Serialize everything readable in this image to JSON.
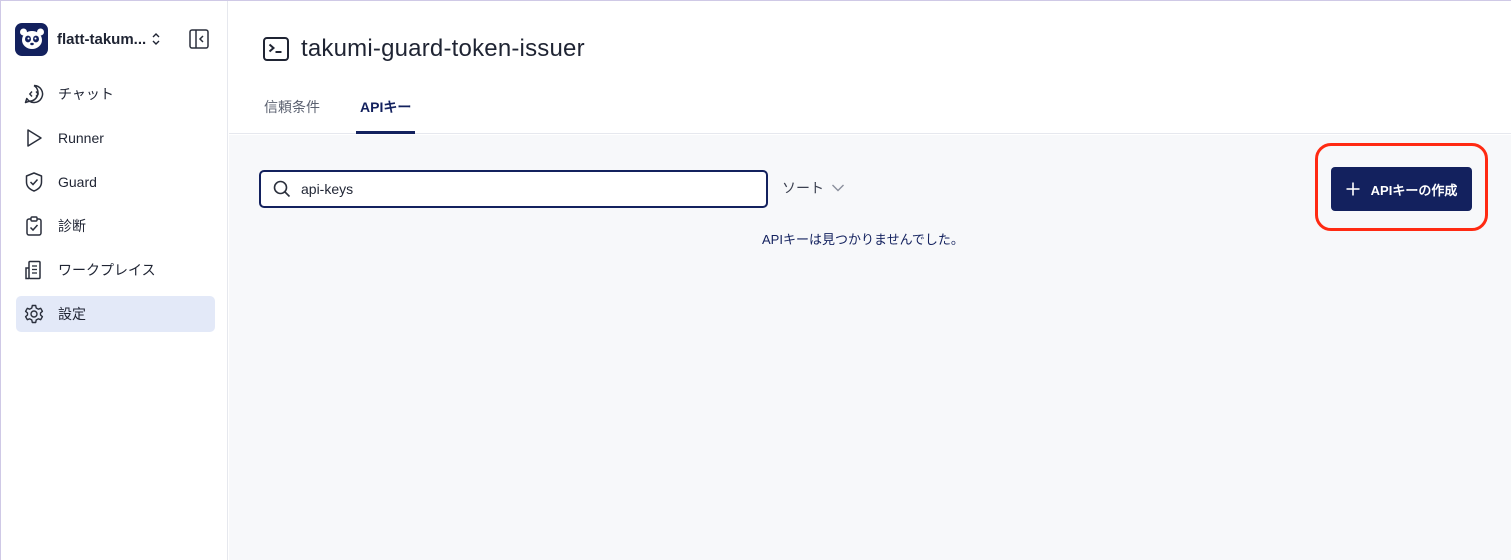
{
  "workspace": {
    "name": "flatt-takum..."
  },
  "nav": [
    {
      "label": "チャット",
      "icon": "chat-icon"
    },
    {
      "label": "Runner",
      "icon": "play-icon"
    },
    {
      "label": "Guard",
      "icon": "shield-check-icon"
    },
    {
      "label": "診断",
      "icon": "clipboard-check-icon"
    },
    {
      "label": "ワークプレイス",
      "icon": "building-icon"
    },
    {
      "label": "設定",
      "icon": "gear-icon",
      "active": true
    }
  ],
  "page": {
    "title": "takumi-guard-token-issuer",
    "icon": "terminal-icon"
  },
  "tabs": [
    {
      "label": "信頼条件"
    },
    {
      "label": "APIキー",
      "active": true
    }
  ],
  "search": {
    "value": "api-keys",
    "icon": "search-icon"
  },
  "sort": {
    "label": "ソート"
  },
  "empty_message": "APIキーは見つかりませんでした。",
  "create_button": {
    "label": "APIキーの作成",
    "icon": "plus-icon"
  },
  "colors": {
    "brand": "#13215e",
    "active_nav": "#e3e9f8",
    "highlight": "#ff2a12",
    "content_bg": "#f7f8fa"
  }
}
